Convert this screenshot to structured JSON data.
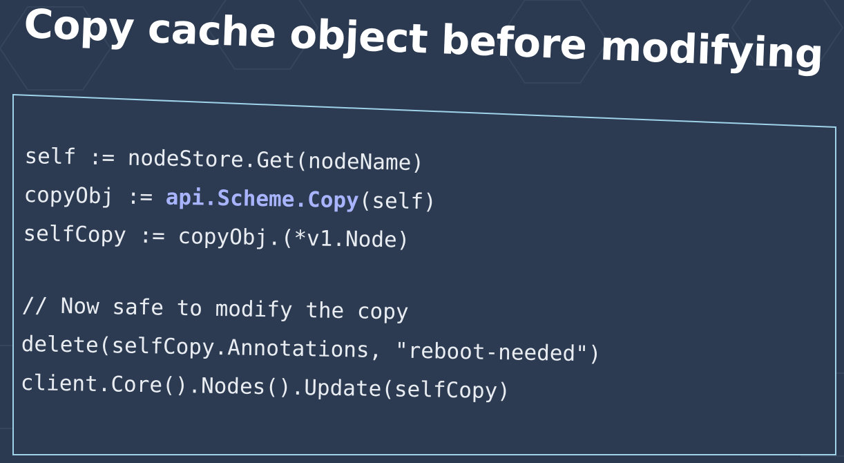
{
  "slide": {
    "title": "Copy cache object before modifying",
    "colors": {
      "background": "#2b3a50",
      "border": "#9fd3ea",
      "text": "#e9edf2",
      "highlight": "#a9b4ff"
    }
  },
  "code": {
    "line1": "self := nodeStore.Get(nodeName)",
    "line2_prefix": "copyObj := ",
    "line2_highlight": "api.Scheme.Copy",
    "line2_suffix": "(self)",
    "line3": "selfCopy := copyObj.(*v1.Node)",
    "line4": "// Now safe to modify the copy",
    "line5": "delete(selfCopy.Annotations, \"reboot-needed\")",
    "line6": "client.Core().Nodes().Update(selfCopy)"
  }
}
